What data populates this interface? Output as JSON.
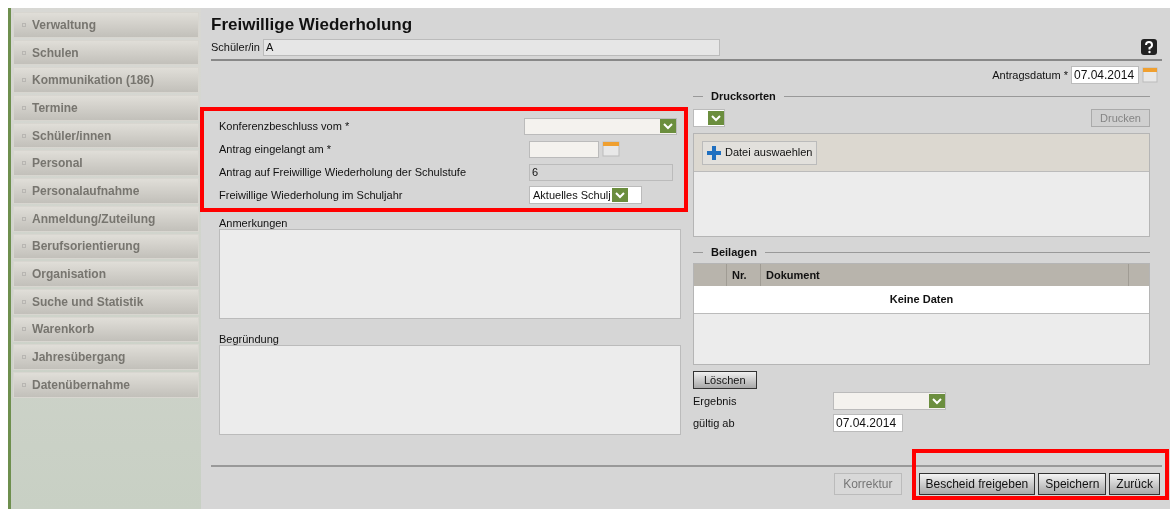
{
  "sidebar": {
    "items": [
      {
        "label": "Verwaltung"
      },
      {
        "label": "Schulen"
      },
      {
        "label": "Kommunikation (186)"
      },
      {
        "label": "Termine"
      },
      {
        "label": "Schüler/innen"
      },
      {
        "label": "Personal"
      },
      {
        "label": "Personalaufnahme"
      },
      {
        "label": "Anmeldung/Zuteilung"
      },
      {
        "label": "Berufsorientierung"
      },
      {
        "label": "Organisation"
      },
      {
        "label": "Suche und Statistik"
      },
      {
        "label": "Warenkorb"
      },
      {
        "label": "Jahresübergang"
      },
      {
        "label": "Datenübernahme"
      }
    ]
  },
  "title": "Freiwillige Wiederholung",
  "student": {
    "label": "Schüler/in",
    "value": "A"
  },
  "application_date": {
    "label": "Antragsdatum *",
    "value": "07.04.2014"
  },
  "form_fields": [
    {
      "kind": "dropdown",
      "label": "Konferenzbeschluss vom *"
    },
    {
      "kind": "date",
      "label": "Antrag eingelangt am *"
    },
    {
      "kind": "text",
      "label": "Antrag auf Freiwillige Wiederholung der Schulstufe",
      "value": "6"
    },
    {
      "kind": "select",
      "label": "Freiwillige Wiederholung im Schuljahr",
      "value": "Aktuelles Schulj"
    }
  ],
  "remarks": {
    "label": "Anmerkungen"
  },
  "justification": {
    "label": "Begründung"
  },
  "print_forms": {
    "title": "Drucksorten",
    "print_button": {
      "label": "Drucken",
      "disabled": true
    },
    "upload_button": "Datei auswaehlen"
  },
  "attachments": {
    "title": "Beilagen",
    "columns": [
      "Nr.",
      "Dokument"
    ],
    "empty_text": "Keine Daten",
    "delete_button": "Löschen"
  },
  "result": {
    "label": "Ergebnis"
  },
  "valid_from": {
    "label": "gültig ab",
    "value": "07.04.2014"
  },
  "buttons": [
    {
      "label": "Korrektur",
      "disabled": true
    },
    {
      "label": "Bescheid freigeben",
      "disabled": false
    },
    {
      "label": "Speichern",
      "disabled": false
    },
    {
      "label": "Zurück",
      "disabled": false
    }
  ]
}
